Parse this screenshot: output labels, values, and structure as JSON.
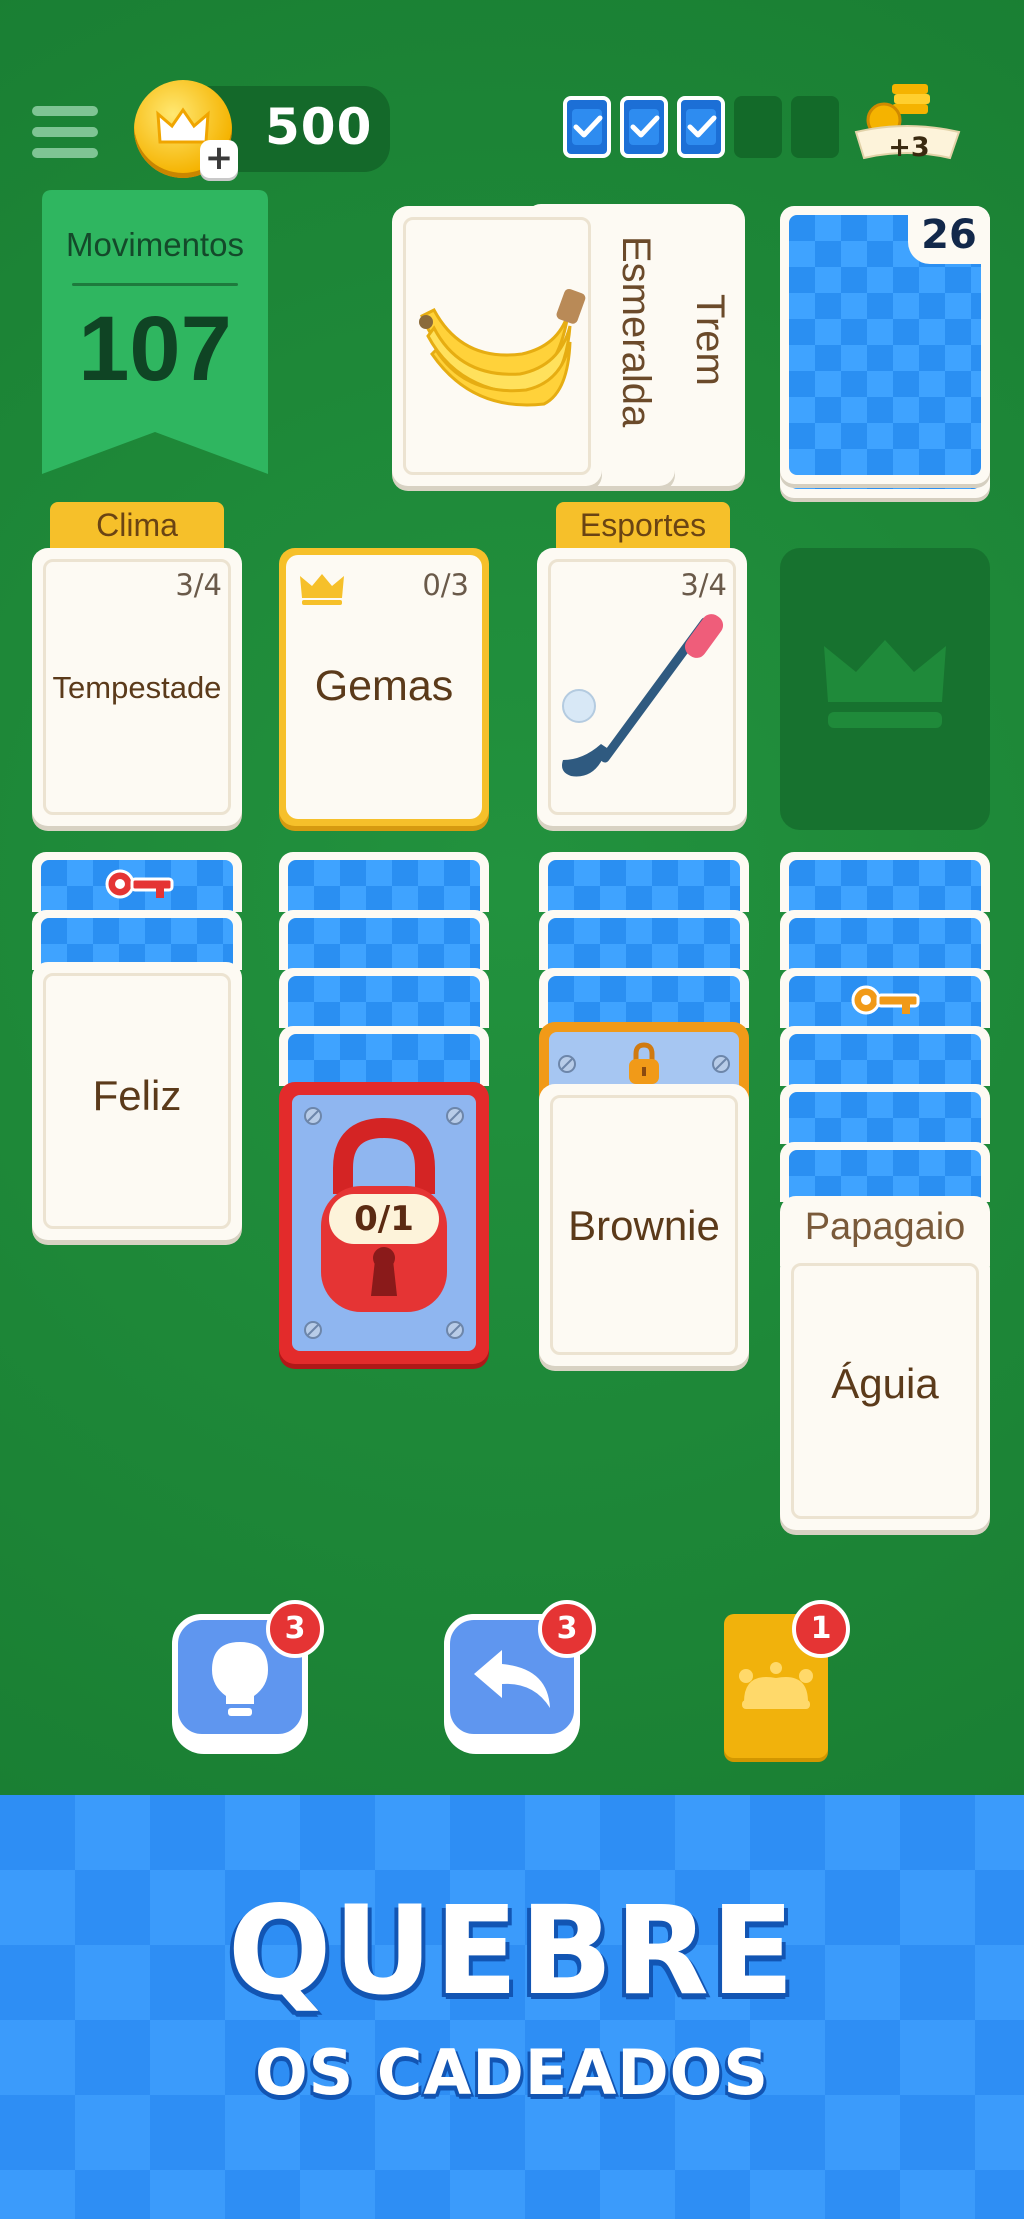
{
  "header": {
    "coins": "500",
    "coin_plus": "+",
    "streak": [
      true,
      true,
      true,
      false,
      false
    ],
    "reward_label": "+3"
  },
  "moves": {
    "title": "Movimentos",
    "value": "107"
  },
  "waste": {
    "front_card": "banana",
    "side_cards": [
      "Esmeralda",
      "Trem"
    ]
  },
  "stock": {
    "count": "26"
  },
  "foundations": [
    {
      "tag": "Clima",
      "count": "3/4",
      "label": "Tempestade"
    },
    {
      "tag": "",
      "count": "0/3",
      "label": "Gemas",
      "crowned": true
    },
    {
      "tag": "Esportes",
      "count": "3/4",
      "label": "golf-club"
    },
    {
      "empty_slot": "crown"
    }
  ],
  "tableau": {
    "col1": {
      "top_card": "Feliz"
    },
    "col2": {
      "lock_label": "0/1"
    },
    "col3": {
      "top_card": "Brownie"
    },
    "col4": {
      "peek_label": "Papagaio",
      "top_card": "Águia"
    }
  },
  "actions": {
    "hint_count": "3",
    "undo_count": "3",
    "joker_count": "1"
  },
  "banner": {
    "title": "QUEBRE",
    "subtitle": "OS CADEADOS"
  },
  "colors": {
    "felt": "#1f8a3a",
    "card_back": "#2a8ff2",
    "tag": "#f6c02a",
    "lock": "#e53434"
  }
}
